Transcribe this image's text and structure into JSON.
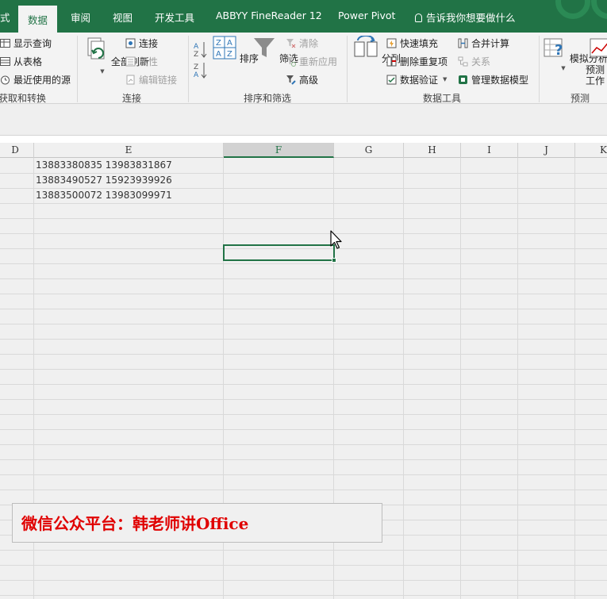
{
  "tabs": {
    "partial_left": "式",
    "data": "数据",
    "review": "审阅",
    "view": "视图",
    "developer": "开发工具",
    "abbyy": "ABBYY FineReader 12",
    "power_pivot": "Power Pivot",
    "tell_me": "告诉我你想要做什么"
  },
  "ribbon": {
    "get_transform": {
      "show_queries": "显示查询",
      "from_table": "从表格",
      "recent_sources": "最近使用的源",
      "label": "获取和转换"
    },
    "connections": {
      "refresh_all": "全部刷新",
      "connections": "连接",
      "properties": "属性",
      "edit_links": "编辑链接",
      "label": "连接"
    },
    "sort_filter": {
      "sort": "排序",
      "filter": "筛选",
      "clear": "清除",
      "reapply": "重新应用",
      "advanced": "高级",
      "label": "排序和筛选"
    },
    "data_tools": {
      "text_to_columns": "分列",
      "flash_fill": "快速填充",
      "remove_duplicates": "删除重复项",
      "data_validation": "数据验证",
      "consolidate": "合并计算",
      "relationships": "关系",
      "manage_data_model": "管理数据模型",
      "label": "数据工具"
    },
    "forecast": {
      "what_if": "模拟分析",
      "forecast_sheet_1": "预测",
      "forecast_sheet_2": "工作",
      "label": "预测"
    }
  },
  "columns": [
    "D",
    "E",
    "F",
    "G",
    "H",
    "I",
    "J",
    "K"
  ],
  "selected_column": "F",
  "cells": [
    "13883380835 13983831867",
    "13883490527 15923939926",
    "13883500072 13983099971"
  ],
  "watermark": "微信公众平台：韩老师讲Office",
  "colors": {
    "excel_green": "#217346",
    "watermark_red": "#e00000"
  }
}
